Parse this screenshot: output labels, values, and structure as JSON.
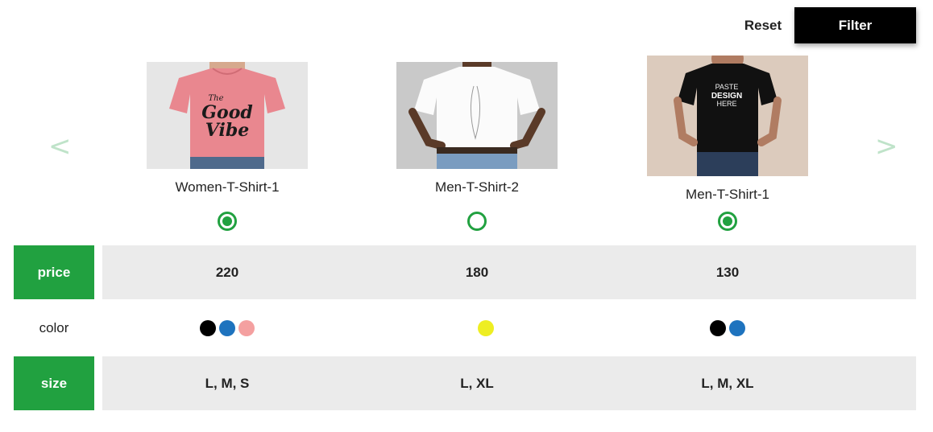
{
  "toolbar": {
    "reset_label": "Reset",
    "filter_label": "Filter"
  },
  "nav": {
    "prev_glyph": "<",
    "next_glyph": ">"
  },
  "products": [
    {
      "name": "Women-T-Shirt-1",
      "selected": true,
      "shirt_color": "#e9878f",
      "photo_bg": "#e6e6e6",
      "print_text": "The Good Vibe",
      "price": "220",
      "colors": [
        "#000000",
        "#1e73be",
        "#f4a0a0"
      ],
      "size": "L, M, S"
    },
    {
      "name": "Men-T-Shirt-2",
      "selected": false,
      "shirt_color": "#fbfbfb",
      "photo_bg": "#c9c9c9",
      "print_text": "",
      "price": "180",
      "colors": [
        "#eeee22"
      ],
      "size": "L, XL"
    },
    {
      "name": "Men-T-Shirt-1",
      "selected": true,
      "shirt_color": "#111111",
      "photo_bg": "#dccbbd",
      "print_text": "PASTE DESIGN HERE",
      "price": "130",
      "colors": [
        "#000000",
        "#1e73be"
      ],
      "size": "L, M, XL"
    }
  ],
  "rows": {
    "price_label": "price",
    "color_label": "color",
    "size_label": "size"
  },
  "theme": {
    "accent": "#21a140",
    "row_shade": "#ebebeb",
    "arrow": "#bfe3c9"
  }
}
